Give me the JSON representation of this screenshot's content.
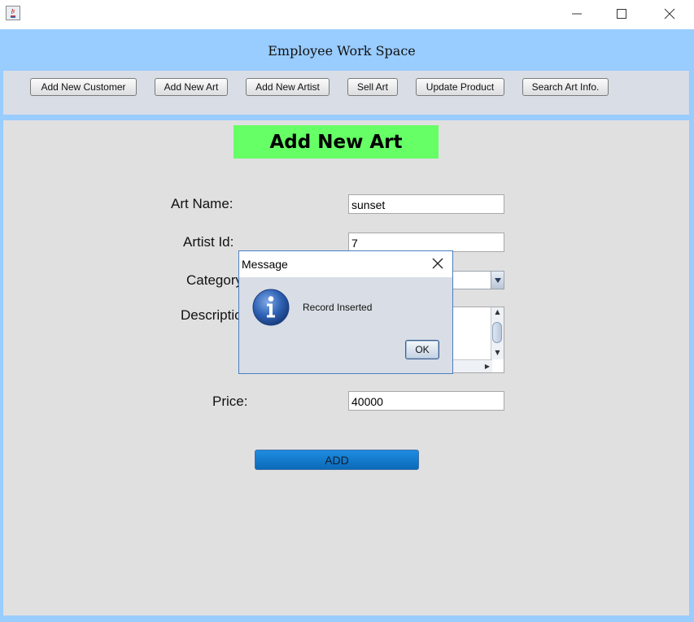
{
  "window": {
    "app_icon": "java-icon",
    "controls": [
      "minimize-icon",
      "maximize-icon",
      "close-icon"
    ]
  },
  "header": {
    "title": "Employee Work Space"
  },
  "toolbar": {
    "buttons": [
      "Add New Customer",
      "Add New Art",
      "Add New Artist",
      "Sell Art",
      "Update Product",
      "Search Art Info."
    ]
  },
  "form": {
    "title": "Add New Art",
    "art_name_label": "Art Name:",
    "art_name_value": "sunset",
    "artist_id_label": "Artist Id:",
    "artist_id_value": "7",
    "category_label": "Category:",
    "description_label": "Description:",
    "price_label": "Price:",
    "price_value": "40000",
    "add_label": "ADD"
  },
  "dialog": {
    "title": "Message",
    "message": "Record Inserted",
    "ok_label": "OK",
    "icon": "info-icon"
  },
  "colors": {
    "frame": "#99ccff",
    "title_badge": "#66ff66",
    "add_button": "#0b6ab8"
  }
}
